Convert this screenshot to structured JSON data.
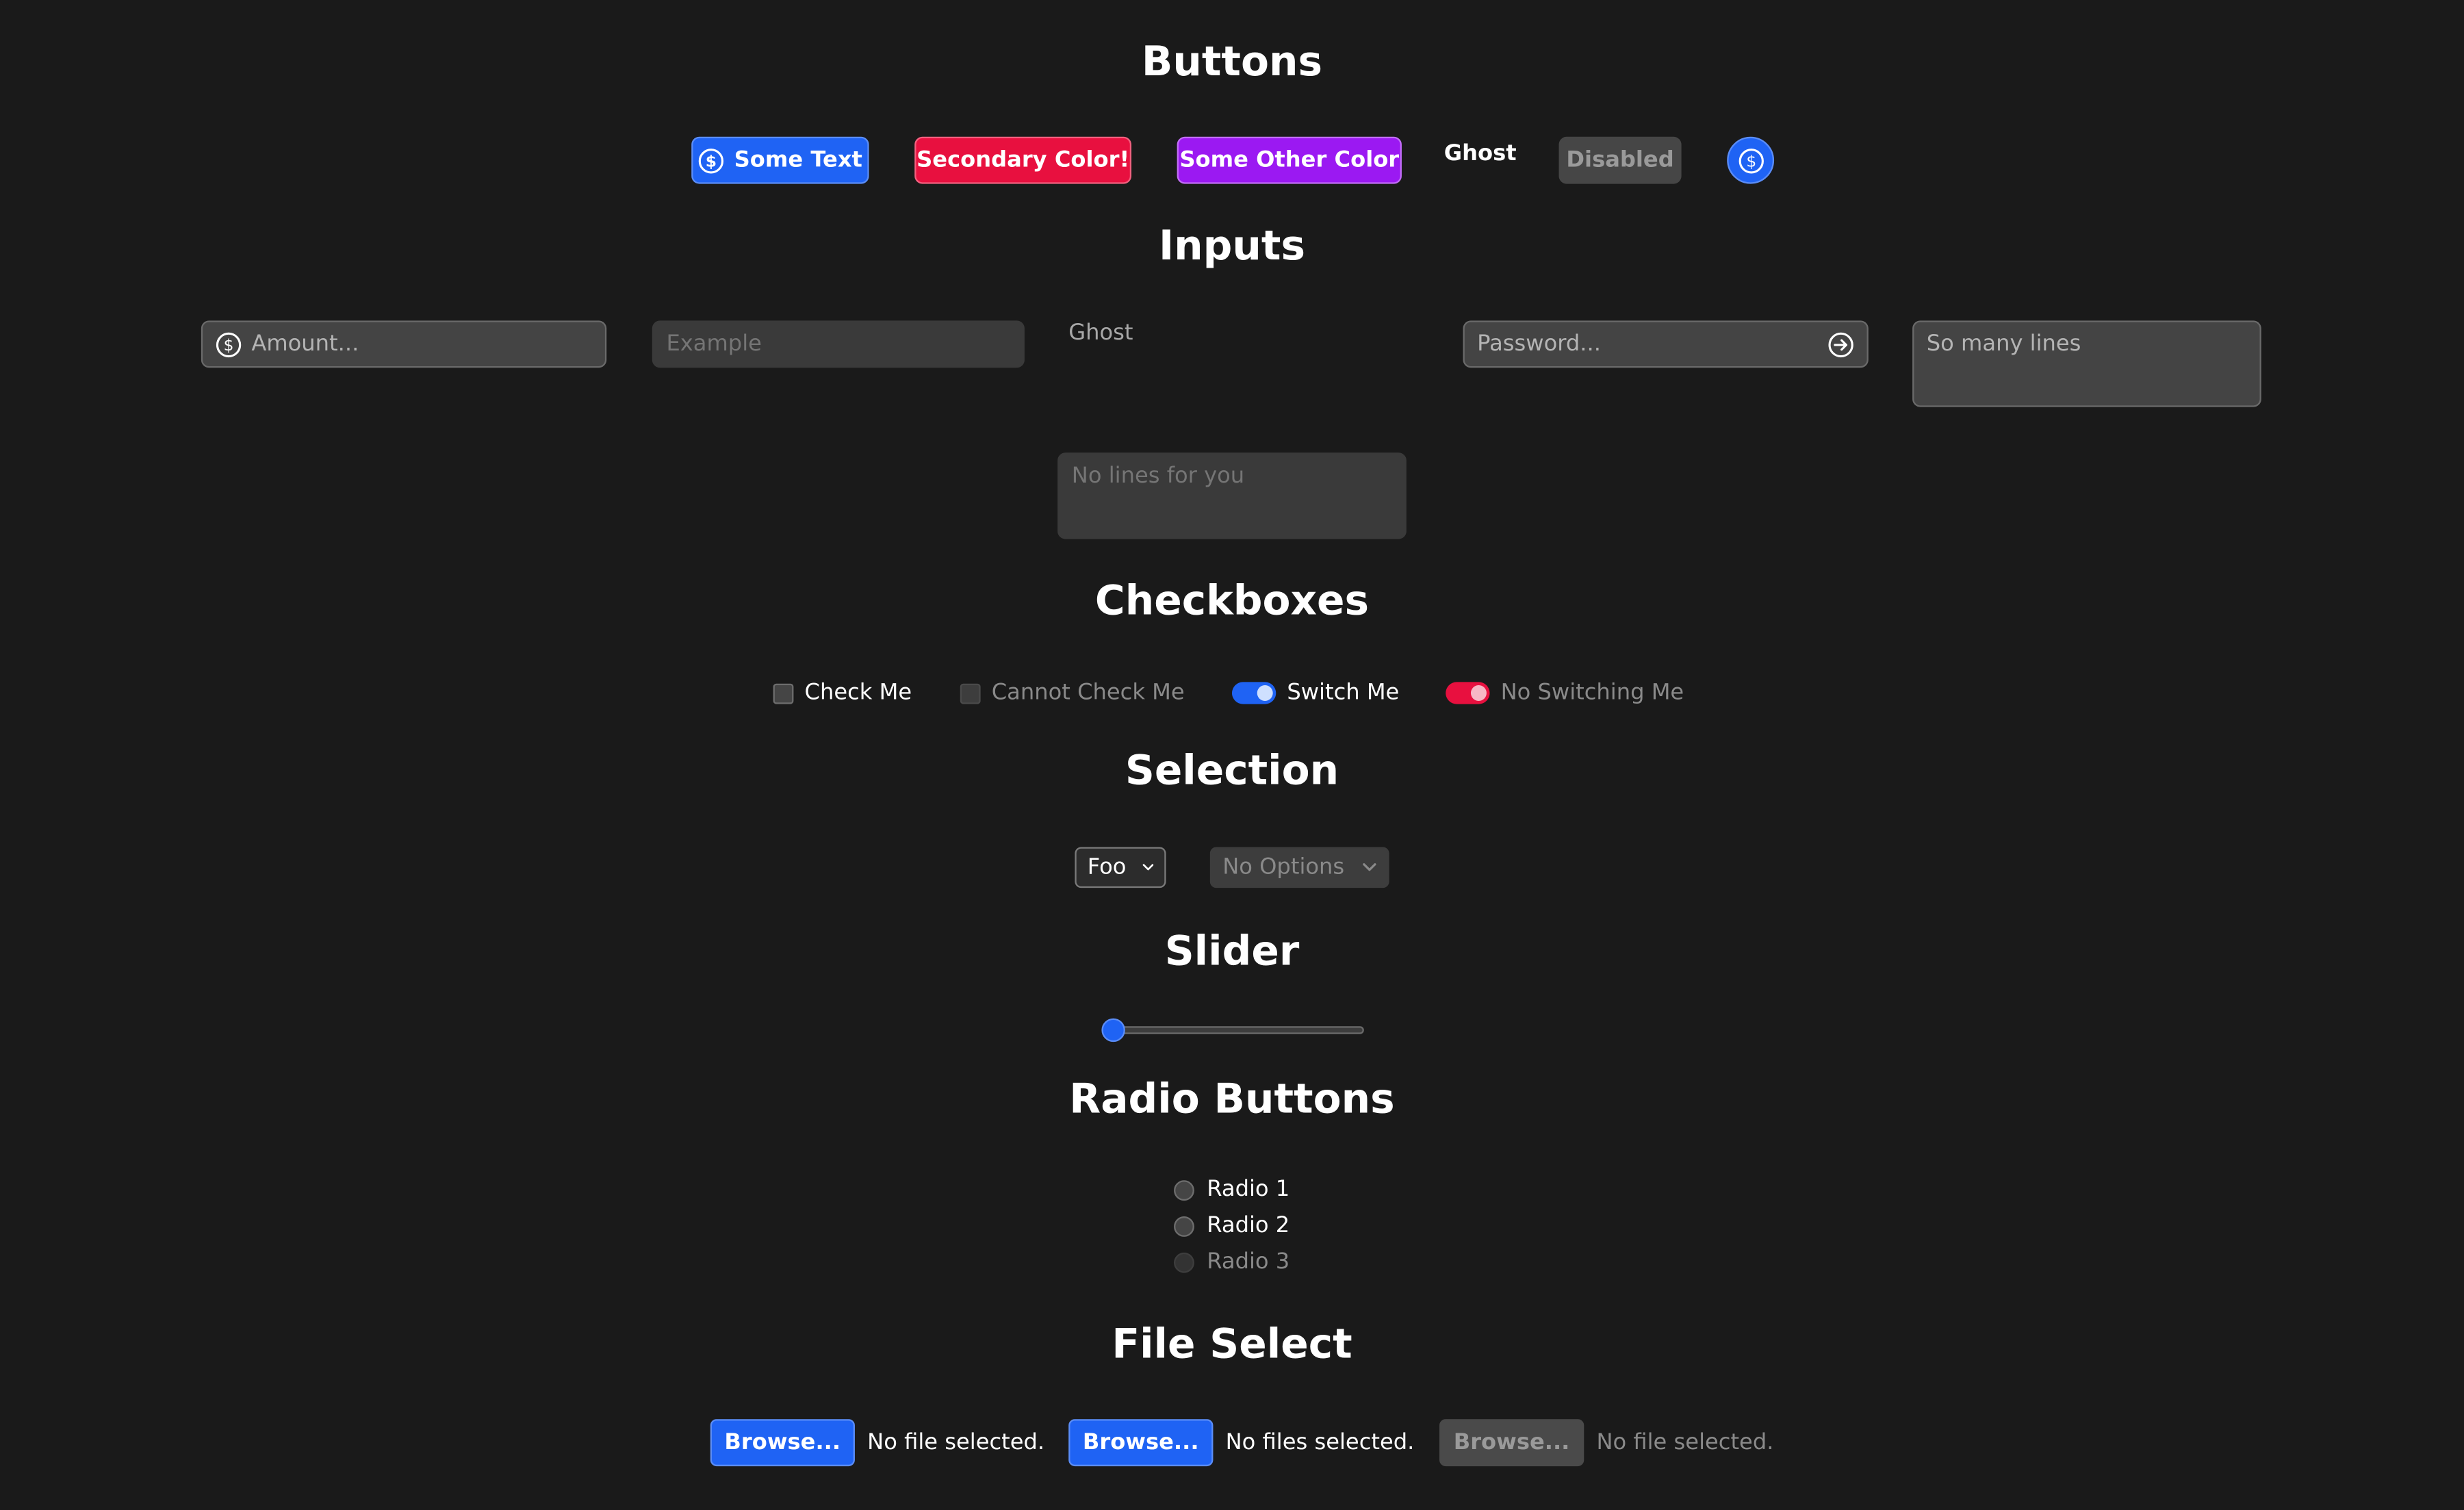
{
  "sections": {
    "buttons": "Buttons",
    "inputs": "Inputs",
    "checkboxes": "Checkboxes",
    "selection": "Selection",
    "slider": "Slider",
    "radio": "Radio Buttons",
    "file": "File Select"
  },
  "buttons": {
    "some_text": "Some Text",
    "secondary": "Secondary Color!",
    "other": "Some Other Color",
    "ghost": "Ghost",
    "disabled": "Disabled"
  },
  "inputs": {
    "amount_placeholder": "Amount...",
    "example_placeholder": "Example",
    "ghost_placeholder": "Ghost",
    "password_placeholder": "Password...",
    "many_lines_placeholder": "So many lines",
    "no_lines_placeholder": "No lines for you"
  },
  "checkboxes": {
    "check_me": "Check Me",
    "cannot_check": "Cannot Check Me",
    "switch_me": "Switch Me",
    "no_switching": "No Switching Me"
  },
  "selection": {
    "foo": "Foo",
    "no_options": "No Options"
  },
  "slider": {
    "value": 0
  },
  "radios": [
    "Radio 1",
    "Radio 2",
    "Radio 3"
  ],
  "files": [
    {
      "button": "Browse...",
      "status": "No file selected."
    },
    {
      "button": "Browse...",
      "status": "No files selected."
    },
    {
      "button": "Browse...",
      "status": "No file selected."
    }
  ],
  "colors": {
    "background": "#1a1a1a",
    "primary": "#1f63f4",
    "secondary": "#e8103f",
    "accent": "#9b19f2"
  }
}
